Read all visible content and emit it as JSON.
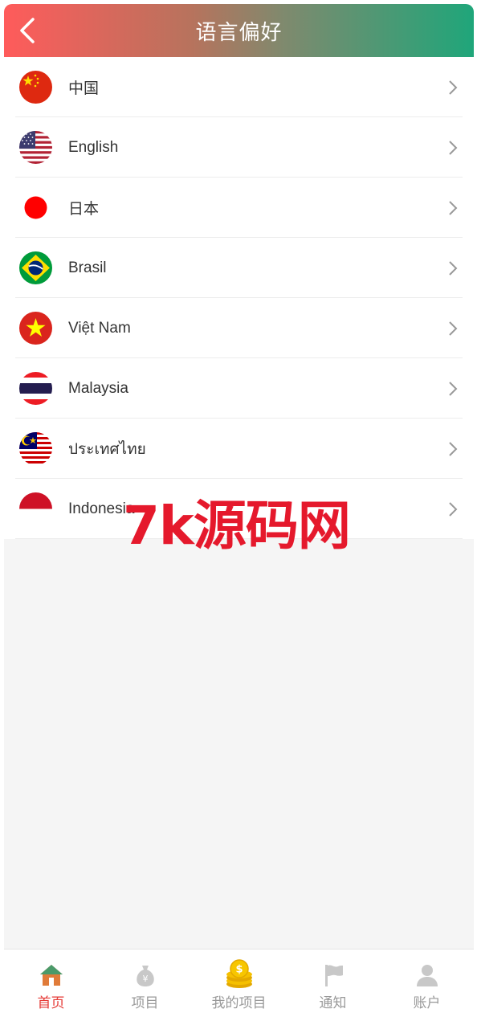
{
  "header": {
    "title": "语言偏好",
    "back_icon": "chevron-left-icon"
  },
  "languages": [
    {
      "label": "中国",
      "flag": "china-flag-icon"
    },
    {
      "label": "English",
      "flag": "usa-flag-icon"
    },
    {
      "label": "日本",
      "flag": "japan-flag-icon"
    },
    {
      "label": "Brasil",
      "flag": "brazil-flag-icon"
    },
    {
      "label": "Việt Nam",
      "flag": "vietnam-flag-icon"
    },
    {
      "label": "Malaysia",
      "flag": "thailand-flag-icon"
    },
    {
      "label": "ประเทศไทย",
      "flag": "malaysia-flag-icon"
    },
    {
      "label": "Indonesia",
      "flag": "indonesia-flag-icon"
    }
  ],
  "watermark": "7k源码网",
  "tabbar": {
    "items": [
      {
        "label": "首页",
        "icon": "home-icon",
        "active": true
      },
      {
        "label": "项目",
        "icon": "money-bag-icon",
        "active": false
      },
      {
        "label": "我的项目",
        "icon": "coin-stack-icon",
        "active": false
      },
      {
        "label": "通知",
        "icon": "flag-icon",
        "active": false
      },
      {
        "label": "账户",
        "icon": "user-icon",
        "active": false
      }
    ]
  },
  "colors": {
    "header_gradient_start": "#ff5b5b",
    "header_gradient_end": "#1fa67a",
    "active_tab": "#e53935",
    "inactive_tab": "#999999",
    "watermark": "#e5192c"
  }
}
